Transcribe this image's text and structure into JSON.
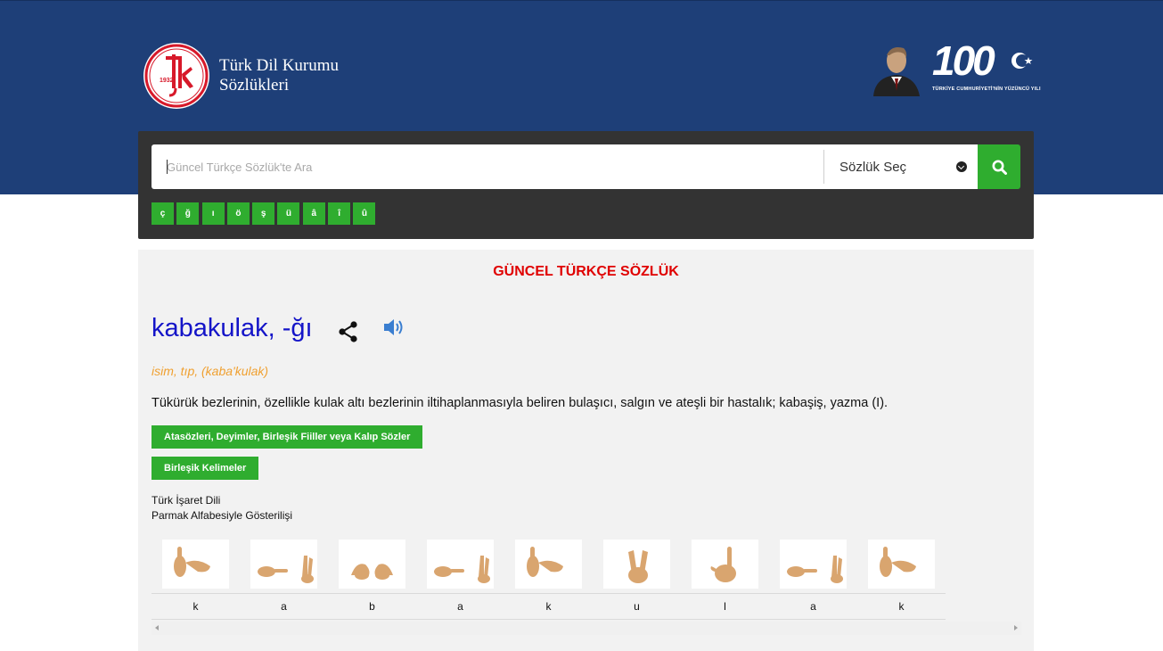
{
  "header": {
    "logo_year": "1932",
    "logo_line1": "Türk Dil Kurumu",
    "logo_line2": "Sözlükleri",
    "centennial_number": "100",
    "centennial_caption": "TÜRKİYE CUMHURİYETİ'NİN YÜZÜNCÜ YILI"
  },
  "search": {
    "placeholder": "Güncel Türkçe Sözlük'te Ara",
    "value": "",
    "dictionary_select": "Sözlük Seç",
    "button_icon": "search-icon"
  },
  "special_letters": [
    "ç",
    "ğ",
    "ı",
    "ö",
    "ş",
    "ü",
    "â",
    "î",
    "û"
  ],
  "result": {
    "dictionary_title": "GÜNCEL TÜRKÇE SÖZLÜK",
    "word": "kabakulak, -ğı",
    "meta": "isim, tıp, (kaba'kulak)",
    "definition": "Tükürük bezlerinin, özellikle kulak altı bezlerinin iltihaplanmasıyla beliren bulaşıcı, salgın ve ateşli bir hastalık; kabaşiş, yazma (I).",
    "buttons": {
      "idioms": "Atasözleri, Deyimler, Birleşik Fiiller veya Kalıp Sözler",
      "compounds": "Birleşik Kelimeler"
    },
    "sign_language": {
      "line1": "Türk İşaret Dili",
      "line2": "Parmak Alfabesiyle Gösterilişi",
      "letters": [
        "k",
        "a",
        "b",
        "a",
        "k",
        "u",
        "l",
        "a",
        "k"
      ]
    }
  },
  "colors": {
    "header_bg": "#1e3f78",
    "panel_bg": "#333333",
    "accent_green": "#2fad2f",
    "title_red": "#e00000",
    "word_blue": "#1414c8",
    "meta_orange": "#f0a030"
  }
}
